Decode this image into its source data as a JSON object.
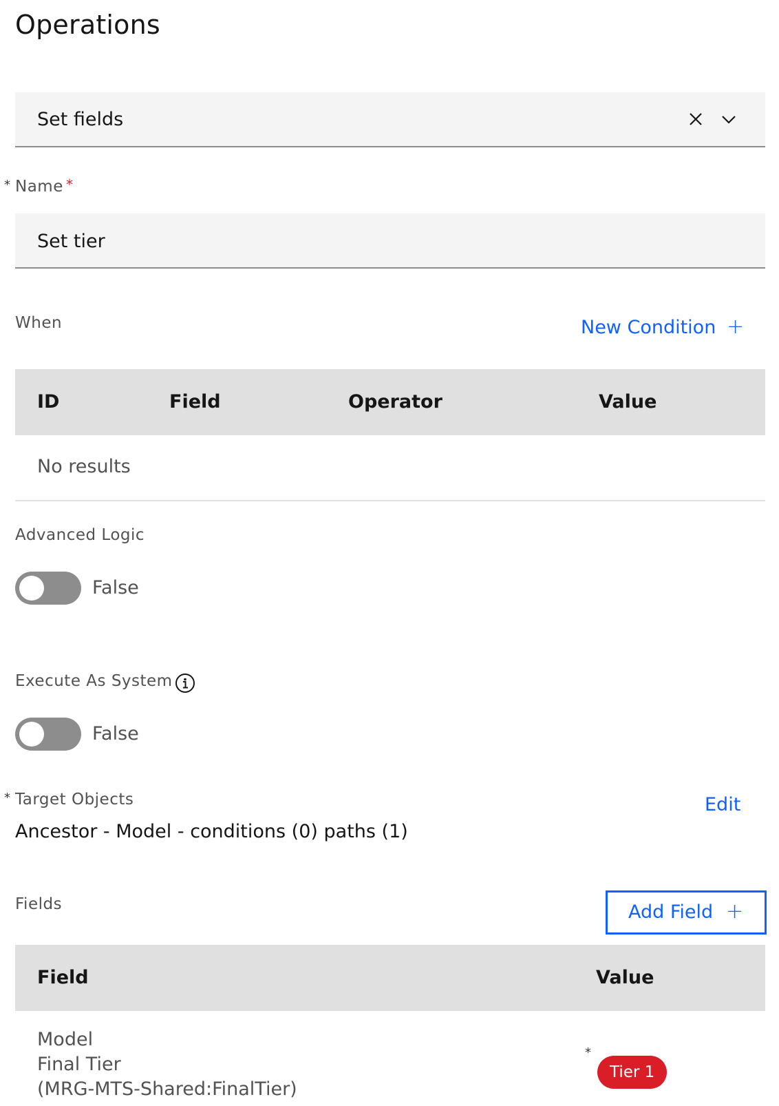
{
  "page": {
    "title": "Operations"
  },
  "operation_select": {
    "value": "Set fields",
    "clear_icon": "close-icon",
    "chevron_icon": "chevron-down-icon"
  },
  "name_field": {
    "asterisk": "*",
    "label": "Name",
    "required_marker": "*",
    "value": "Set tier"
  },
  "when": {
    "label": "When",
    "new_condition_label": "New Condition",
    "plus": "+",
    "columns": [
      "ID",
      "Field",
      "Operator",
      "Value"
    ],
    "empty_text": "No results"
  },
  "advanced_logic": {
    "label": "Advanced Logic",
    "state_text": "False",
    "checked": false
  },
  "execute_as_system": {
    "label": "Execute As System",
    "info_icon": "info-icon",
    "state_text": "False",
    "checked": false
  },
  "target_objects": {
    "asterisk": "*",
    "label": "Target Objects",
    "edit_label": "Edit",
    "value": "Ancestor - Model - conditions (0) paths (1)"
  },
  "fields": {
    "label": "Fields",
    "add_field_label": "Add Field",
    "plus": "+",
    "columns": [
      "Field",
      "Value"
    ],
    "rows": [
      {
        "field_line1": "Model",
        "field_line2": "Final Tier",
        "field_line3": "(MRG-MTS-Shared:FinalTier)",
        "value_asterisk": "*",
        "value_tag": "Tier 1",
        "tag_color": "#da1e28"
      }
    ]
  },
  "colors": {
    "link": "#0f62fe",
    "danger": "#da1e28",
    "field_bg": "#f4f4f4",
    "table_header_bg": "#e0e0e0",
    "toggle_off": "#8d8d8d"
  }
}
